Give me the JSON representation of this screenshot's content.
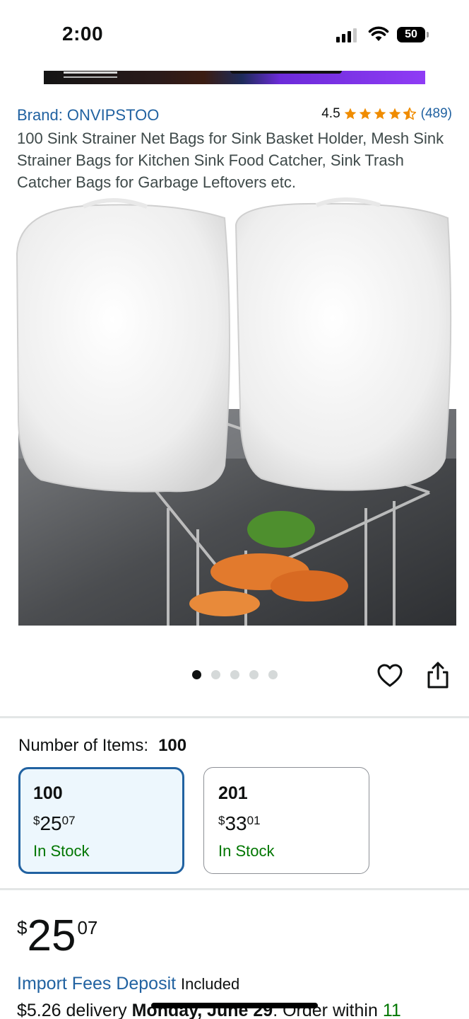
{
  "status_bar": {
    "time": "2:00",
    "battery": "50"
  },
  "product": {
    "brand": "Brand: ONVIPSTOO",
    "rating_value": "4.5",
    "rating_stars": 4.5,
    "rating_count": "(489)",
    "title": "100 Sink Strainer Net Bags for Sink Basket Holder, Mesh Sink Strainer Bags for Kitchen Sink Food Catcher, Sink Trash Catcher Bags for Garbage Leftovers etc.",
    "image_count": 5,
    "image_active_index": 0
  },
  "variations": {
    "label": "Number of Items:",
    "selected_value": "100",
    "options": [
      {
        "count": "100",
        "currency": "$",
        "whole": "25",
        "cents": "07",
        "stock": "In Stock",
        "selected": true
      },
      {
        "count": "201",
        "currency": "$",
        "whole": "33",
        "cents": "01",
        "stock": "In Stock",
        "selected": false
      }
    ]
  },
  "price": {
    "currency": "$",
    "whole": "25",
    "cents": "07"
  },
  "import_fees": {
    "link": "Import Fees Deposit",
    "status": "Included"
  },
  "delivery": {
    "cost": "$5.26 delivery",
    "date": "Monday, June 29",
    "suffix": ". Order within",
    "countdown": "11"
  },
  "colors": {
    "link_blue": "#2162a1",
    "in_stock_green": "#007600",
    "star_orange": "#f08c00",
    "selected_bg": "#edf7fd"
  }
}
